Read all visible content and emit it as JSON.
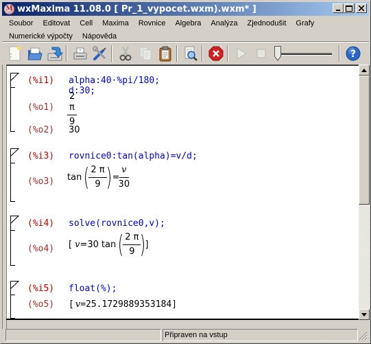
{
  "window": {
    "title": "wxMaxima 11.08.0 [ Pr_1_vypocet.wxm).wxm* ]",
    "app_icon": "M",
    "controls": {
      "minimize": "_",
      "maximize": "□",
      "close": "✕"
    }
  },
  "menu": {
    "row1": [
      "Soubor",
      "Editovat",
      "Cell",
      "Maxima",
      "Rovnice",
      "Algebra",
      "Analýza",
      "Zjednodušit",
      "Grafy"
    ],
    "row2": [
      "Numerické výpočty",
      "Nápověda"
    ]
  },
  "toolbar": {
    "buttons": [
      {
        "name": "new-document",
        "icon": "new-file-icon"
      },
      {
        "name": "open",
        "icon": "folder-open-icon"
      },
      {
        "name": "save",
        "icon": "save-icon"
      },
      {
        "name": "print",
        "icon": "print-icon"
      },
      {
        "name": "settings",
        "icon": "tools-icon"
      },
      {
        "name": "cut",
        "icon": "scissors-icon",
        "disabled": true
      },
      {
        "name": "copy",
        "icon": "copy-icon",
        "disabled": true
      },
      {
        "name": "paste",
        "icon": "clipboard-icon"
      },
      {
        "name": "find",
        "icon": "find-icon"
      },
      {
        "name": "interrupt",
        "icon": "stop-sign-icon"
      },
      {
        "name": "animation-play",
        "icon": "play-icon",
        "disabled": true
      },
      {
        "name": "animation-stop",
        "icon": "stop-square-icon",
        "disabled": true
      },
      {
        "name": "help",
        "icon": "help-icon"
      }
    ],
    "slider_value": 0
  },
  "cells": [
    {
      "input_label": "(%i1)",
      "input": "alpha:40·%pi/180; d:30;",
      "outputs": [
        {
          "label": "(%o1)",
          "type": "fraction",
          "numerator": "2 π",
          "denominator": "9"
        },
        {
          "label": "(%o2)",
          "type": "text",
          "value": "30"
        }
      ]
    },
    {
      "input_label": "(%i3)",
      "input": "rovnice0:tan(alpha)=v/d;",
      "outputs": [
        {
          "label": "(%o3)",
          "type": "equation",
          "func": "tan",
          "arg_num": "2 π",
          "arg_den": "9",
          "eq": "=",
          "rhs_num": "v",
          "rhs_den": "30"
        }
      ]
    },
    {
      "input_label": "(%i4)",
      "input": "solve(rovnice0,v);",
      "outputs": [
        {
          "label": "(%o4)",
          "type": "solution",
          "open": "[",
          "var": "v",
          "eq": "=",
          "coef": "30",
          "func": "tan",
          "arg_num": "2 π",
          "arg_den": "9",
          "close": "]"
        }
      ]
    },
    {
      "input_label": "(%i5)",
      "input": "float(%);",
      "outputs": [
        {
          "label": "(%o5)",
          "type": "solution-float",
          "open": "[",
          "var": "v",
          "eq": "=",
          "value": "25.1729889353184",
          "close": "]"
        }
      ]
    }
  ],
  "statusbar": {
    "left": "",
    "right": "Připraven na vstup"
  },
  "colors": {
    "input_label": "#c00000",
    "output_label": "#a03030",
    "input_text": "#0000e0",
    "titlebar_start": "#0a246a",
    "titlebar_end": "#a6caf0"
  }
}
